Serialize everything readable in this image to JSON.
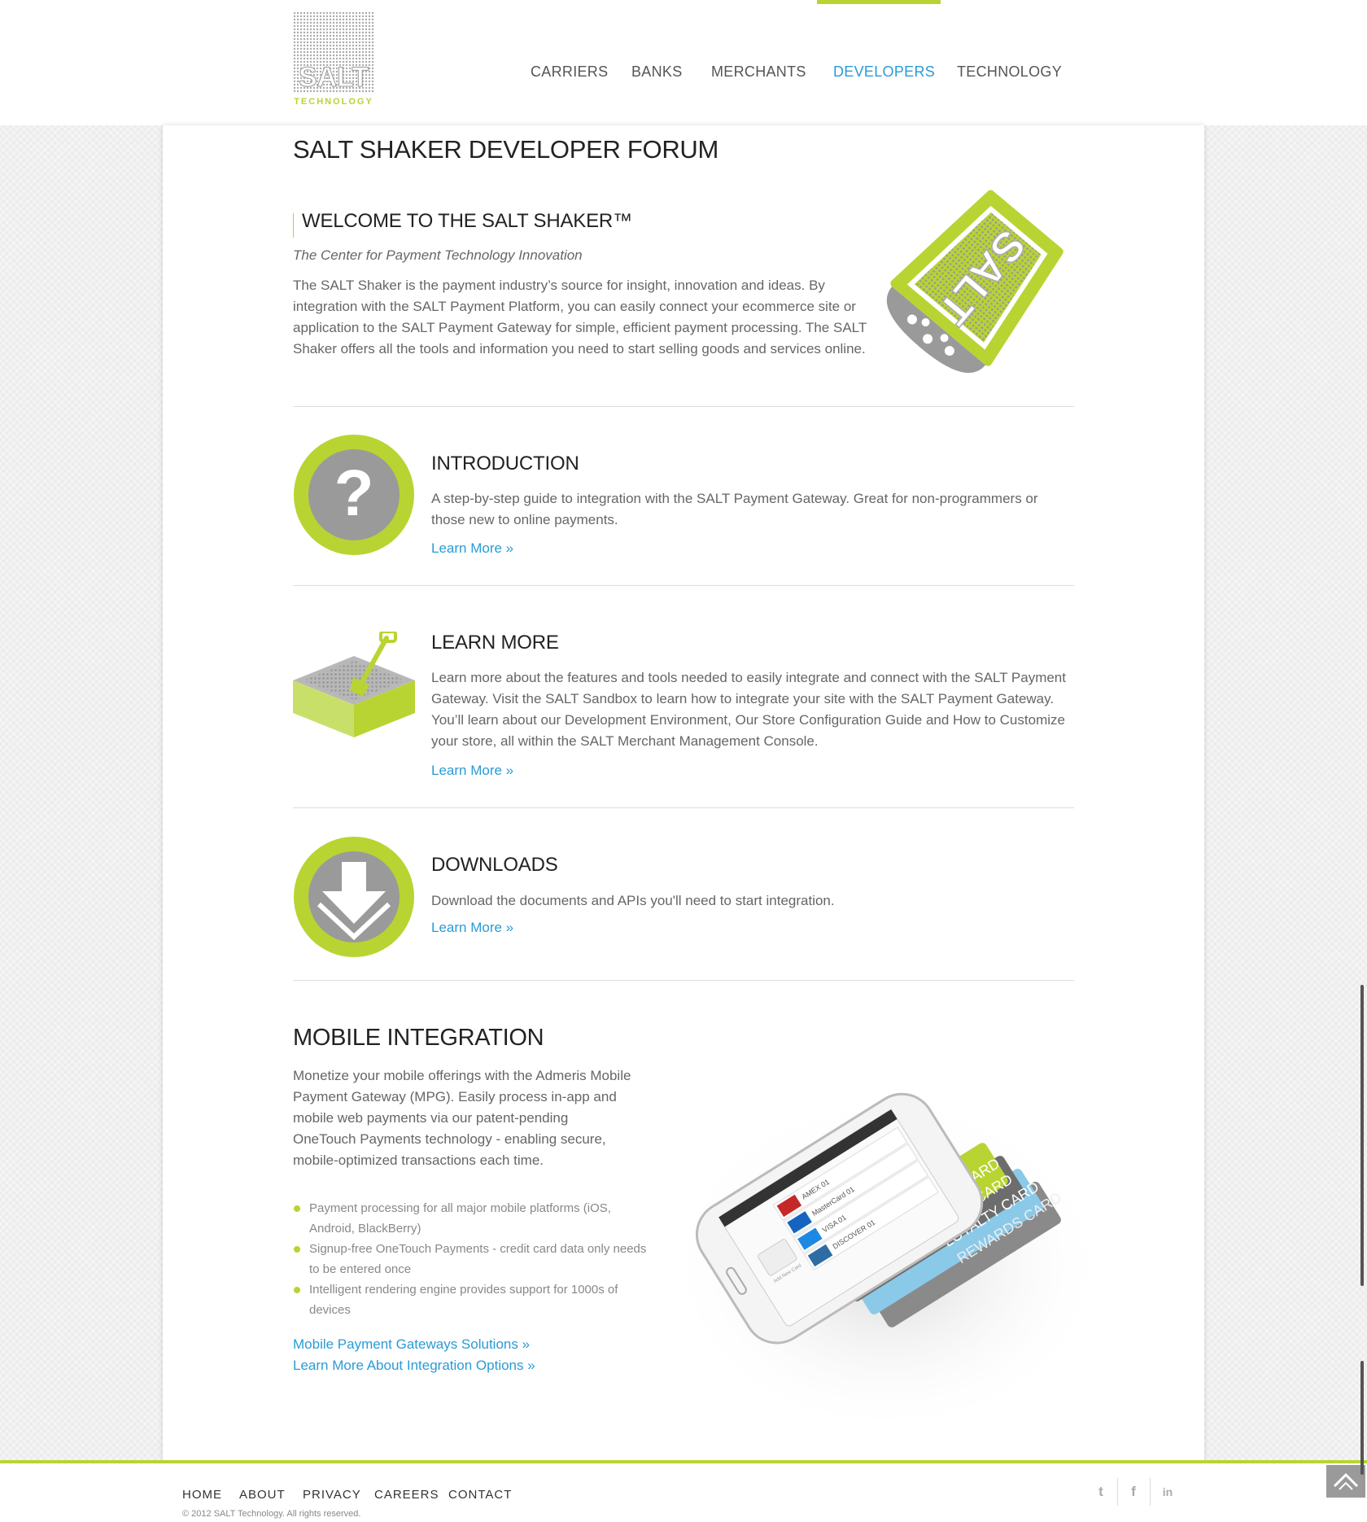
{
  "logo": {
    "text": "SALT",
    "subtext": "TECHNOLOGY"
  },
  "nav": [
    {
      "label": "CARRIERS",
      "active": false
    },
    {
      "label": "BANKS",
      "active": false
    },
    {
      "label": "MERCHANTS",
      "active": false
    },
    {
      "label": "DEVELOPERS",
      "active": true
    },
    {
      "label": "TECHNOLOGY",
      "active": false
    }
  ],
  "page_title": "SALT SHAKER DEVELOPER FORUM",
  "welcome": {
    "title": "WELCOME TO THE SALT SHAKER™",
    "subtitle": "The Center for Payment Technology Innovation",
    "body": "The SALT Shaker is the payment industry’s source for insight, innovation and ideas. By integration with the SALT Payment Platform, you can easily connect your ecommerce site or application to the SALT Payment Gateway for simple, efficient payment processing. The SALT Shaker offers all the tools and information you need to start selling goods and services online.",
    "shaker_label": "SALT"
  },
  "sections": [
    {
      "icon": "question-icon",
      "title": "INTRODUCTION",
      "body": "A step-by-step guide to integration with the SALT Payment Gateway. Great for non-programmers or those new to online payments.",
      "link": "Learn More »"
    },
    {
      "icon": "shovel-icon",
      "title": "LEARN MORE",
      "body": "Learn more about the features and tools needed to easily integrate and connect with the SALT Payment Gateway. Visit the SALT Sandbox to learn how to integrate your site with the SALT Payment Gateway. You’ll learn about our Development Environment, Our Store Configuration Guide and How to Customize your store, all within the SALT Merchant Management Console.",
      "link": "Learn More »"
    },
    {
      "icon": "download-icon",
      "title": "DOWNLOADS",
      "body": "Download the documents and APIs you'll need to start integration.",
      "link": "Learn More »"
    }
  ],
  "mobile": {
    "title": "MOBILE INTEGRATION",
    "body": "Monetize your mobile offerings with the Admeris Mobile Payment Gateway (MPG). Easily process in-app and mobile web payments via our patent-pending OneTouch Payments technology - enabling secure, mobile-optimized transactions each time.",
    "bullets": [
      "Payment processing for all major mobile platforms (iOS, Android, BlackBerry)",
      "Signup-free OneTouch Payments - credit card data only needs to be entered once",
      "Intelligent rendering engine provides support for 1000s of devices"
    ],
    "links": [
      "Mobile Payment Gateways Solutions »",
      "Learn More About Integration Options »"
    ],
    "cards": [
      "CREDIT CARD",
      "DEBIT CARD",
      "LOYALTY CARD",
      "REWARDS CARD"
    ],
    "phone_rows": [
      "AMEX 01",
      "MasterCard 01",
      "VISA 01",
      "DISCOVER 01"
    ],
    "phone_button": "Add New Card"
  },
  "footer": {
    "links": [
      "HOME",
      "ABOUT",
      "PRIVACY",
      "CAREERS",
      "CONTACT"
    ],
    "copyright": "© 2012 SALT Technology. All rights reserved.",
    "social": [
      {
        "name": "twitter-icon",
        "glyph": "t"
      },
      {
        "name": "facebook-icon",
        "glyph": "f"
      },
      {
        "name": "linkedin-icon",
        "glyph": "in"
      }
    ]
  },
  "colors": {
    "accent": "#b8d432",
    "link": "#2a9bd6",
    "icon_gray": "#9a9a9a"
  }
}
